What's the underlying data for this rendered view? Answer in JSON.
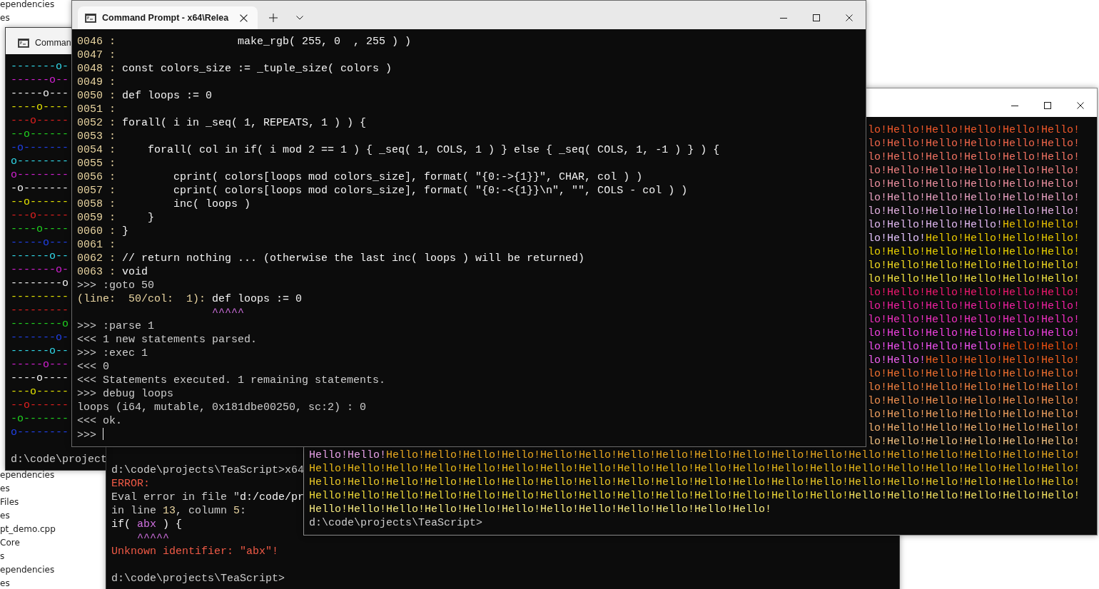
{
  "explorer": {
    "top_items": [
      "ependencies",
      "es"
    ],
    "bottom_items": [
      "ependencies",
      "es",
      "Files",
      "es",
      "pt_demo.cpp",
      "Core",
      "s",
      "ependencies",
      "es"
    ]
  },
  "error_window": {
    "lines": [
      {
        "segments": [
          {
            "text": "d:\\code\\projects\\TeaScript>x64",
            "color": "#cccccc"
          }
        ]
      },
      {
        "segments": [
          {
            "text": "ERROR:",
            "color": "#f05a46"
          }
        ]
      },
      {
        "segments": [
          {
            "text": "Eval error in file \"",
            "color": "#cccccc"
          },
          {
            "text": "d:/code/pr",
            "color": "#f2f2f2"
          }
        ]
      },
      {
        "segments": [
          {
            "text": "in line ",
            "color": "#cccccc"
          },
          {
            "text": "13",
            "color": "#e8d4a0"
          },
          {
            "text": ", column ",
            "color": "#cccccc"
          },
          {
            "text": "5",
            "color": "#e8d4a0"
          },
          {
            "text": ":",
            "color": "#cccccc"
          }
        ]
      },
      {
        "segments": [
          {
            "text": "if( ",
            "color": "#f2f2f2"
          },
          {
            "text": "abx",
            "color": "#d070e0"
          },
          {
            "text": " ) {",
            "color": "#f2f2f2"
          }
        ]
      },
      {
        "segments": [
          {
            "text": "    ^^^^^",
            "color": "#d070e0"
          }
        ]
      },
      {
        "segments": [
          {
            "text": "Unknown identifier: \"abx\"!",
            "color": "#f05a46"
          }
        ]
      }
    ],
    "prompt": "d:\\code\\projects\\TeaScript>"
  },
  "pattern_window": {
    "tab_title": "Comman",
    "rows": [
      {
        "text": "-------o-",
        "color": "#30d8e8"
      },
      {
        "text": "------o--",
        "color": "#d020d0"
      },
      {
        "text": "-----o---",
        "color": "#f0f0f0"
      },
      {
        "text": "----o----",
        "color": "#e0e000"
      },
      {
        "text": "---o-----",
        "color": "#e02020"
      },
      {
        "text": "--o------",
        "color": "#20d020"
      },
      {
        "text": "-o-------",
        "color": "#2040e8"
      },
      {
        "text": "o--------",
        "color": "#30d8e8"
      },
      {
        "text": "o--------",
        "color": "#d020d0"
      },
      {
        "text": "-o-------",
        "color": "#f0f0f0"
      },
      {
        "text": "--o------",
        "color": "#e0e000"
      },
      {
        "text": "---o-----",
        "color": "#e02020"
      },
      {
        "text": "----o----",
        "color": "#20d020"
      },
      {
        "text": "-----o---",
        "color": "#2040e8"
      },
      {
        "text": "------o--",
        "color": "#30d8e8"
      },
      {
        "text": "-------o-",
        "color": "#d020d0"
      },
      {
        "text": "--------o",
        "color": "#f0f0f0"
      },
      {
        "text": "---------",
        "color": "#e0e000"
      },
      {
        "text": "---------",
        "color": "#e02020"
      },
      {
        "text": "--------o",
        "color": "#20d020"
      },
      {
        "text": "-------o-",
        "color": "#2040e8"
      },
      {
        "text": "------o--",
        "color": "#30d8e8"
      },
      {
        "text": "-----o---",
        "color": "#d020d0"
      },
      {
        "text": "----o----",
        "color": "#f0f0f0"
      },
      {
        "text": "---o-----",
        "color": "#e0e000"
      },
      {
        "text": "--o------",
        "color": "#e02020"
      },
      {
        "text": "-o-------",
        "color": "#20d020"
      },
      {
        "text": "o--------",
        "color": "#2040e8"
      }
    ],
    "prompt": "d:\\code\\project"
  },
  "hello_window": {
    "top_rows": [
      {
        "segments": [
          {
            "text": "lo!Hello!Hello!Hello!Hello!Hello!",
            "color": "#f0582a"
          }
        ]
      },
      {
        "segments": [
          {
            "text": "lo!Hello!Hello!Hello!Hello!Hello!",
            "color": "#f0654a"
          }
        ]
      },
      {
        "segments": [
          {
            "text": "lo!Hello!Hello!Hello!Hello!Hello!",
            "color": "#f07262"
          }
        ]
      },
      {
        "segments": [
          {
            "text": "lo!Hello!Hello!Hello!Hello!Hello!",
            "color": "#f08080"
          }
        ]
      },
      {
        "segments": [
          {
            "text": "lo!Hello!Hello!Hello!Hello!Hello!",
            "color": "#ee90a0"
          }
        ]
      },
      {
        "segments": [
          {
            "text": "lo!Hello!Hello!Hello!Hello!Hello!",
            "color": "#e8a0c0"
          }
        ]
      },
      {
        "segments": [
          {
            "text": "lo!Hello!Hello!Hello!Hello!Hello!",
            "color": "#e2b0e0"
          }
        ]
      },
      {
        "segments": [
          {
            "text": "lo!Hello!Hello!Hello!",
            "color": "#e0b8f0"
          },
          {
            "text": "Hello!Hello!",
            "color": "#e8c000"
          }
        ]
      },
      {
        "segments": [
          {
            "text": "lo!Hello!",
            "color": "#e0c0f8"
          },
          {
            "text": "Hello!Hello!Hello!Hello!",
            "color": "#e8c800"
          }
        ]
      },
      {
        "segments": [
          {
            "text": "lo!Hello!Hello!Hello!Hello!Hello!",
            "color": "#e8d000"
          }
        ]
      },
      {
        "segments": [
          {
            "text": "lo!Hello!Hello!Hello!Hello!Hello!",
            "color": "#f0d820"
          }
        ]
      },
      {
        "segments": [
          {
            "text": "lo!Hello!Hello!Hello!Hello!Hello!",
            "color": "#f0e040"
          }
        ]
      },
      {
        "segments": [
          {
            "text": "lo!Hello!Hello!Hello!Hello!Hello!",
            "color": "#f01870"
          }
        ]
      },
      {
        "segments": [
          {
            "text": "lo!Hello!Hello!Hello!Hello!Hello!",
            "color": "#f020a0"
          }
        ]
      },
      {
        "segments": [
          {
            "text": "lo!Hello!Hello!Hello!Hello!Hello!",
            "color": "#f030c0"
          }
        ]
      },
      {
        "segments": [
          {
            "text": "lo!Hello!Hello!Hello!Hello!Hello!",
            "color": "#f040e0"
          }
        ]
      },
      {
        "segments": [
          {
            "text": "lo!Hello!Hello!Hello!",
            "color": "#f050f0"
          },
          {
            "text": "Hello!Hello!",
            "color": "#f05010"
          }
        ]
      },
      {
        "segments": [
          {
            "text": "lo!Hello!",
            "color": "#f060f0"
          },
          {
            "text": "Hello!Hello!Hello!Hello!",
            "color": "#f06020"
          }
        ]
      },
      {
        "segments": [
          {
            "text": "lo!Hello!Hello!Hello!Hello!Hello!",
            "color": "#f07030"
          }
        ]
      },
      {
        "segments": [
          {
            "text": "lo!Hello!Hello!Hello!Hello!Hello!",
            "color": "#f08040"
          }
        ]
      },
      {
        "segments": [
          {
            "text": "lo!Hello!Hello!Hello!Hello!Hello!",
            "color": "#f09050"
          }
        ]
      },
      {
        "segments": [
          {
            "text": "lo!Hello!Hello!Hello!Hello!Hello!",
            "color": "#f0a060"
          }
        ]
      },
      {
        "segments": [
          {
            "text": "lo!Hello!Hello!Hello!Hello!Hello!",
            "color": "#f0b070"
          }
        ]
      },
      {
        "segments": [
          {
            "text": "lo!Hello!Hello!Hello!Hello!Hello!",
            "color": "#f0c080"
          }
        ]
      }
    ],
    "bottom_rows": [
      {
        "segments": [
          {
            "text": "Hello!Hello!",
            "color": "#e6a0e6"
          },
          {
            "text": "Hello!Hello!Hello!Hello!Hello!Hello!Hello!Hello!Hello!Hello!Hello!Hello!Hello!Hello!Hello!Hello!Hello!Hello!",
            "color": "#e8a820"
          }
        ]
      },
      {
        "segments": [
          {
            "text": "Hello!Hello!Hello!Hello!Hello!Hello!Hello!Hello!Hello!Hello!Hello!Hello!Hello!Hello!Hello!Hello!Hello!Hello!Hello!Hello!",
            "color": "#e8b818"
          }
        ]
      },
      {
        "segments": [
          {
            "text": "Hello!Hello!Hello!Hello!Hello!Hello!Hello!Hello!Hello!Hello!Hello!Hello!Hello!Hello!Hello!Hello!Hello!Hello!Hello!Hello!",
            "color": "#eac828"
          }
        ]
      },
      {
        "segments": [
          {
            "text": "Hello!Hello!Hello!Hello!Hello!Hello!Hello!Hello!Hello!Hello!Hello!Hello!Hello!Hello!",
            "color": "#eed838"
          },
          {
            "text": "Hello!Hello!Hello!Hello!Hello!Hello!",
            "color": "#f2e060"
          }
        ]
      },
      {
        "segments": [
          {
            "text": "Hello!Hello!Hello!Hello!Hello!Hello!Hello!Hello!Hello!Hello!Hello!Hello!",
            "color": "#f4e880"
          }
        ]
      }
    ],
    "prompt": "d:\\code\\projects\\TeaScript>"
  },
  "main_window": {
    "tab": {
      "title": "Command Prompt - x64\\Relea",
      "selected": true
    },
    "lines": [
      {
        "kind": "code",
        "number": "0046 :",
        "text": "                  make_rgb( 255, 0  , 255 ) )"
      },
      {
        "kind": "code",
        "number": "0047 :"
      },
      {
        "kind": "code",
        "number": "0048 :",
        "text": "const colors_size := _tuple_size( colors )"
      },
      {
        "kind": "code",
        "number": "0049 :"
      },
      {
        "kind": "code",
        "number": "0050 :",
        "text": "def loops := 0"
      },
      {
        "kind": "code",
        "number": "0051 :"
      },
      {
        "kind": "code",
        "number": "0052 :",
        "text": "forall( i in _seq( 1, REPEATS, 1 ) ) {"
      },
      {
        "kind": "code",
        "number": "0053 :"
      },
      {
        "kind": "code",
        "number": "0054 :",
        "text": "    forall( col in if( i mod 2 == 1 ) { _seq( 1, COLS, 1 ) } else { _seq( COLS, 1, -1 ) } ) {"
      },
      {
        "kind": "code",
        "number": "0055 :"
      },
      {
        "kind": "code",
        "number": "0056 :",
        "text": "        cprint( colors[loops mod colors_size], format( \"{0:->{1}}\", CHAR, col ) )"
      },
      {
        "kind": "code",
        "number": "0057 :",
        "text": "        cprint( colors[loops mod colors_size], format( \"{0:-<{1}}\\n\", \"\", COLS - col ) )"
      },
      {
        "kind": "code",
        "number": "0058 :",
        "text": "        inc( loops )"
      },
      {
        "kind": "code",
        "number": "0059 :",
        "text": "    }"
      },
      {
        "kind": "code",
        "number": "0060 :",
        "text": "}"
      },
      {
        "kind": "code",
        "number": "0061 :"
      },
      {
        "kind": "code",
        "number": "0062 :",
        "text": "// return nothing ... (otherwise the last inc( loops ) will be returned)"
      },
      {
        "kind": "code",
        "number": "0063 :",
        "text": "void"
      },
      {
        "kind": "output",
        "text": ">>> :goto 50"
      },
      {
        "kind": "position",
        "prefix": "(line:  50/col:  1): ",
        "text": "def loops := 0"
      },
      {
        "kind": "marker",
        "text": "                     ^^^^^"
      },
      {
        "kind": "output",
        "text": ">>> :parse 1"
      },
      {
        "kind": "output",
        "text": "<<< 1 new statements parsed."
      },
      {
        "kind": "output",
        "text": ">>> :exec 1"
      },
      {
        "kind": "output",
        "text": "<<< 0"
      },
      {
        "kind": "output",
        "text": "<<< Statements executed. 1 remaining statements."
      },
      {
        "kind": "output",
        "text": ">>> debug loops"
      },
      {
        "kind": "output",
        "text": "loops (i64, mutable, 0x181dbe00250, sc:2) : 0"
      },
      {
        "kind": "output",
        "text": "<<< ok."
      },
      {
        "kind": "cursor",
        "text": ">>>"
      }
    ]
  }
}
